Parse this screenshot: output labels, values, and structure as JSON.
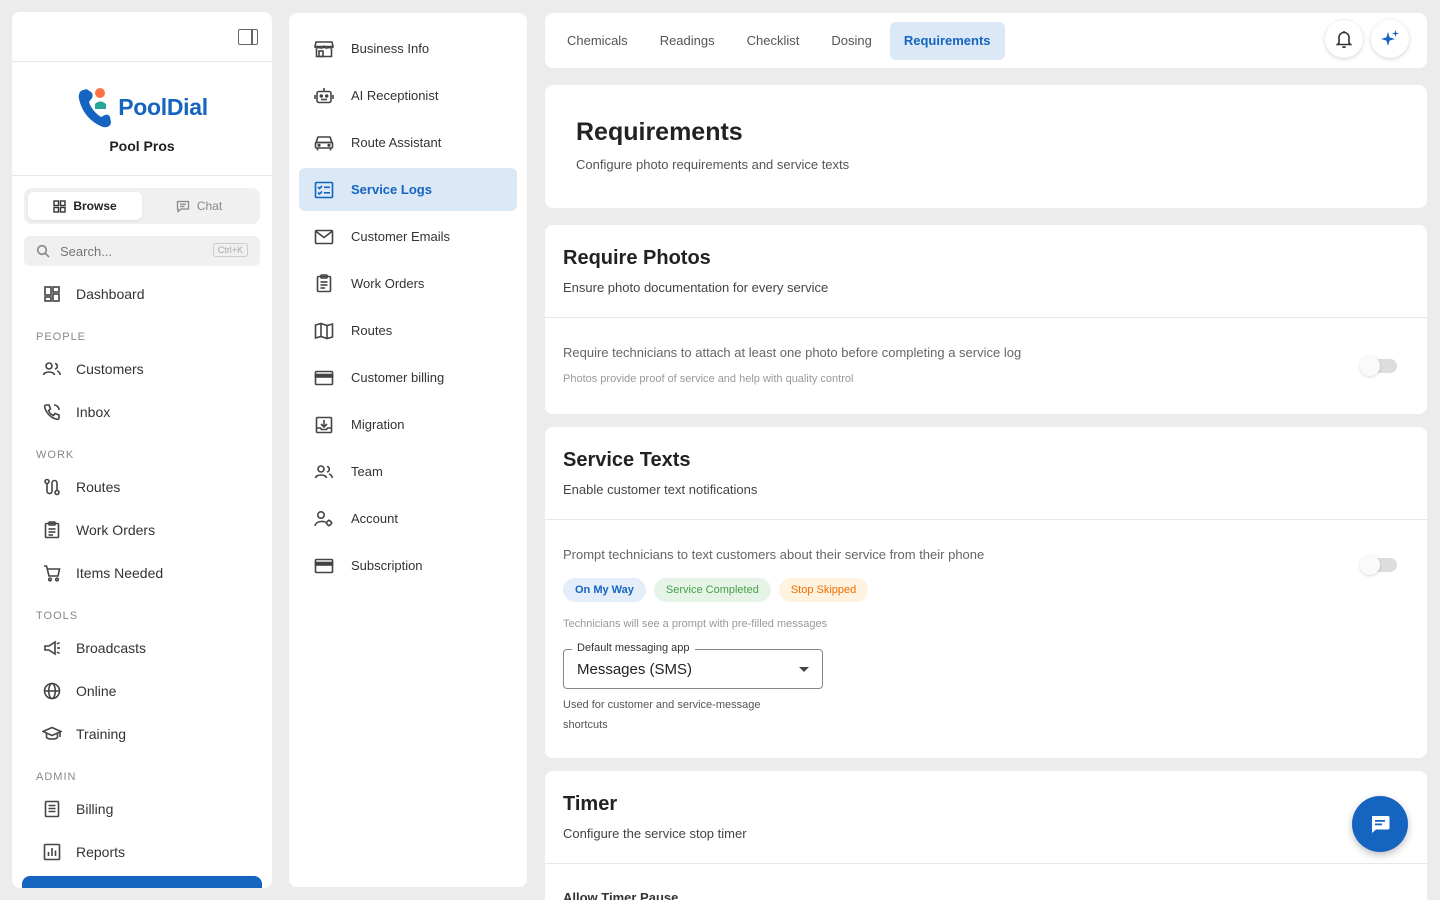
{
  "app": {
    "brand_name": "PoolDial",
    "org_name": "Pool Pros"
  },
  "sidebar": {
    "toggle": {
      "browse": "Browse",
      "chat": "Chat"
    },
    "search": {
      "placeholder": "Search...",
      "shortcut": "Ctrl+K"
    },
    "dashboard": "Dashboard",
    "sections": {
      "people": "PEOPLE",
      "work": "WORK",
      "tools": "TOOLS",
      "admin": "ADMIN"
    },
    "items": {
      "customers": "Customers",
      "inbox": "Inbox",
      "routes": "Routes",
      "work_orders": "Work Orders",
      "items_needed": "Items Needed",
      "broadcasts": "Broadcasts",
      "online": "Online",
      "training": "Training",
      "billing": "Billing",
      "reports": "Reports"
    }
  },
  "settings_nav": {
    "items": [
      {
        "label": "Business Info",
        "icon": "store-icon"
      },
      {
        "label": "AI Receptionist",
        "icon": "robot-icon"
      },
      {
        "label": "Route Assistant",
        "icon": "car-icon"
      },
      {
        "label": "Service Logs",
        "icon": "checklist-icon",
        "active": true
      },
      {
        "label": "Customer Emails",
        "icon": "mail-icon"
      },
      {
        "label": "Work Orders",
        "icon": "clipboard-icon"
      },
      {
        "label": "Routes",
        "icon": "map-icon"
      },
      {
        "label": "Customer billing",
        "icon": "credit-card-icon"
      },
      {
        "label": "Migration",
        "icon": "import-icon"
      },
      {
        "label": "Team",
        "icon": "team-icon"
      },
      {
        "label": "Account",
        "icon": "account-settings-icon"
      },
      {
        "label": "Subscription",
        "icon": "credit-card-icon"
      }
    ]
  },
  "tabs": {
    "chemicals": "Chemicals",
    "readings": "Readings",
    "checklist": "Checklist",
    "dosing": "Dosing",
    "requirements": "Requirements"
  },
  "page": {
    "title": "Requirements",
    "subtitle": "Configure photo requirements and service texts"
  },
  "require_photos": {
    "title": "Require Photos",
    "subtitle": "Ensure photo documentation for every service",
    "setting_label": "Require technicians to attach at least one photo before completing a service log",
    "setting_hint": "Photos provide proof of service and help with quality control",
    "enabled": false
  },
  "service_texts": {
    "title": "Service Texts",
    "subtitle": "Enable customer text notifications",
    "setting_label": "Prompt technicians to text customers about their service from their phone",
    "enabled": false,
    "chips": {
      "on_my_way": "On My Way",
      "service_completed": "Service Completed",
      "stop_skipped": "Stop Skipped"
    },
    "chips_hint": "Technicians will see a prompt with pre-filled messages",
    "messaging_app": {
      "label": "Default messaging app",
      "value": "Messages (SMS)",
      "helper_line1": "Used for customer and service-message",
      "helper_line2": "shortcuts"
    }
  },
  "timer": {
    "title": "Timer",
    "subtitle": "Configure the service stop timer",
    "first_setting": "Allow Timer Pause"
  },
  "colors": {
    "accent": "#1565c0",
    "accent_light": "#dbe8f6",
    "chip_green": "#43a047",
    "chip_orange": "#ef6c00"
  }
}
